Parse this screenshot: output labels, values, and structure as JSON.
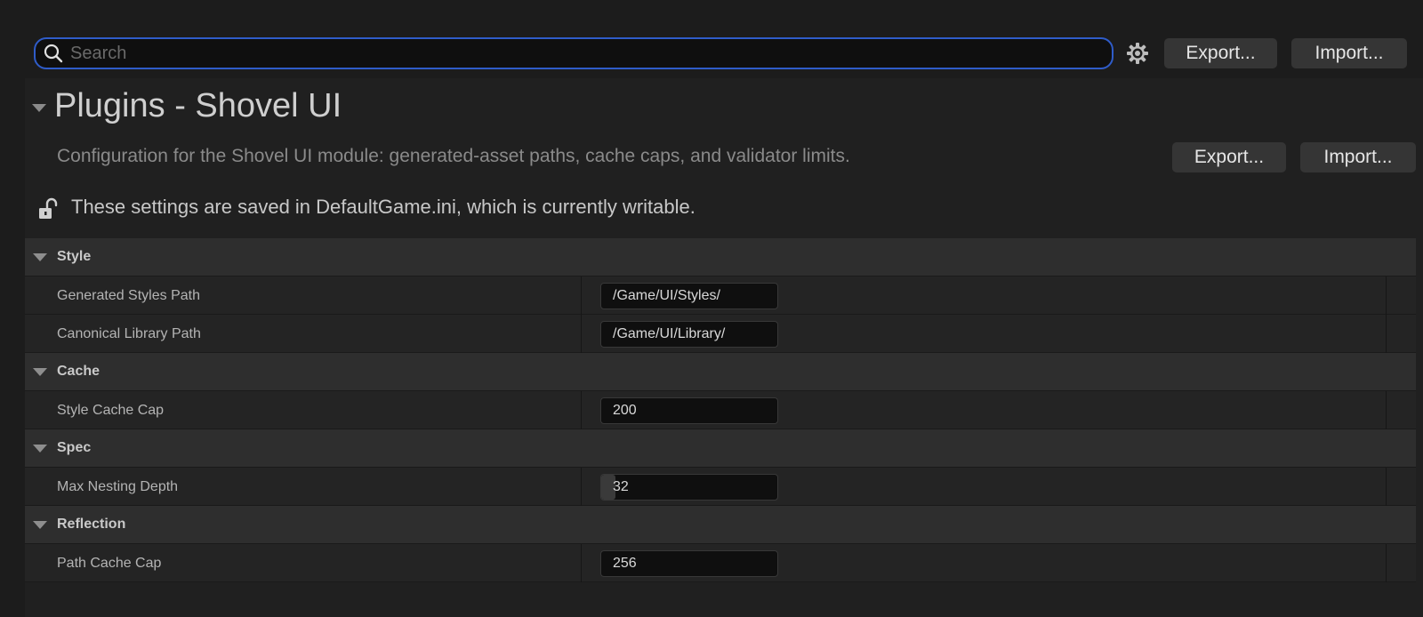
{
  "search": {
    "placeholder": "Search",
    "value": ""
  },
  "toolbar": {
    "export_label": "Export...",
    "import_label": "Import..."
  },
  "section": {
    "title": "Plugins - Shovel UI",
    "description": "Configuration for the Shovel UI module: generated-asset paths, cache caps, and validator limits.",
    "export_label": "Export...",
    "import_label": "Import...",
    "saved_note": "These settings are saved in DefaultGame.ini, which is currently writable."
  },
  "categories": [
    {
      "label": "Style",
      "properties": [
        {
          "label": "Generated Styles Path",
          "value": "/Game/UI/Styles/"
        },
        {
          "label": "Canonical Library Path",
          "value": "/Game/UI/Library/"
        }
      ]
    },
    {
      "label": "Cache",
      "properties": [
        {
          "label": "Style Cache Cap",
          "value": "200"
        }
      ]
    },
    {
      "label": "Spec",
      "properties": [
        {
          "label": "Max Nesting Depth",
          "value": "32",
          "slider_fraction": 0.08
        }
      ]
    },
    {
      "label": "Reflection",
      "properties": [
        {
          "label": "Path Cache Cap",
          "value": "256"
        }
      ]
    }
  ],
  "colors": {
    "background": "#1c1c1c",
    "focus_border": "#2f5cc9",
    "category_row": "#2e2e2e",
    "property_row": "#242424"
  }
}
